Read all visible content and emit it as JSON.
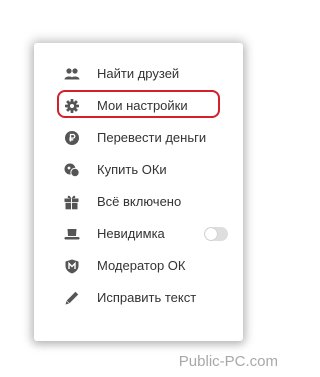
{
  "menu": {
    "items": [
      {
        "label": "Найти друзей",
        "icon": "friends-icon"
      },
      {
        "label": "Мои настройки",
        "icon": "gear-icon",
        "highlighted": true
      },
      {
        "label": "Перевести деньги",
        "icon": "ruble-coin-icon"
      },
      {
        "label": "Купить ОКи",
        "icon": "ok-coins-icon"
      },
      {
        "label": "Всё включено",
        "icon": "gift-icon"
      },
      {
        "label": "Невидимка",
        "icon": "invisible-hat-icon",
        "toggle": false
      },
      {
        "label": "Модератор ОК",
        "icon": "moderator-shield-icon"
      },
      {
        "label": "Исправить текст",
        "icon": "pencil-icon"
      }
    ]
  },
  "watermark": "Public-PC.com",
  "colors": {
    "icon": "#555555",
    "text": "#333333",
    "highlight": "#d42027",
    "watermark": "#a8a8a8"
  }
}
